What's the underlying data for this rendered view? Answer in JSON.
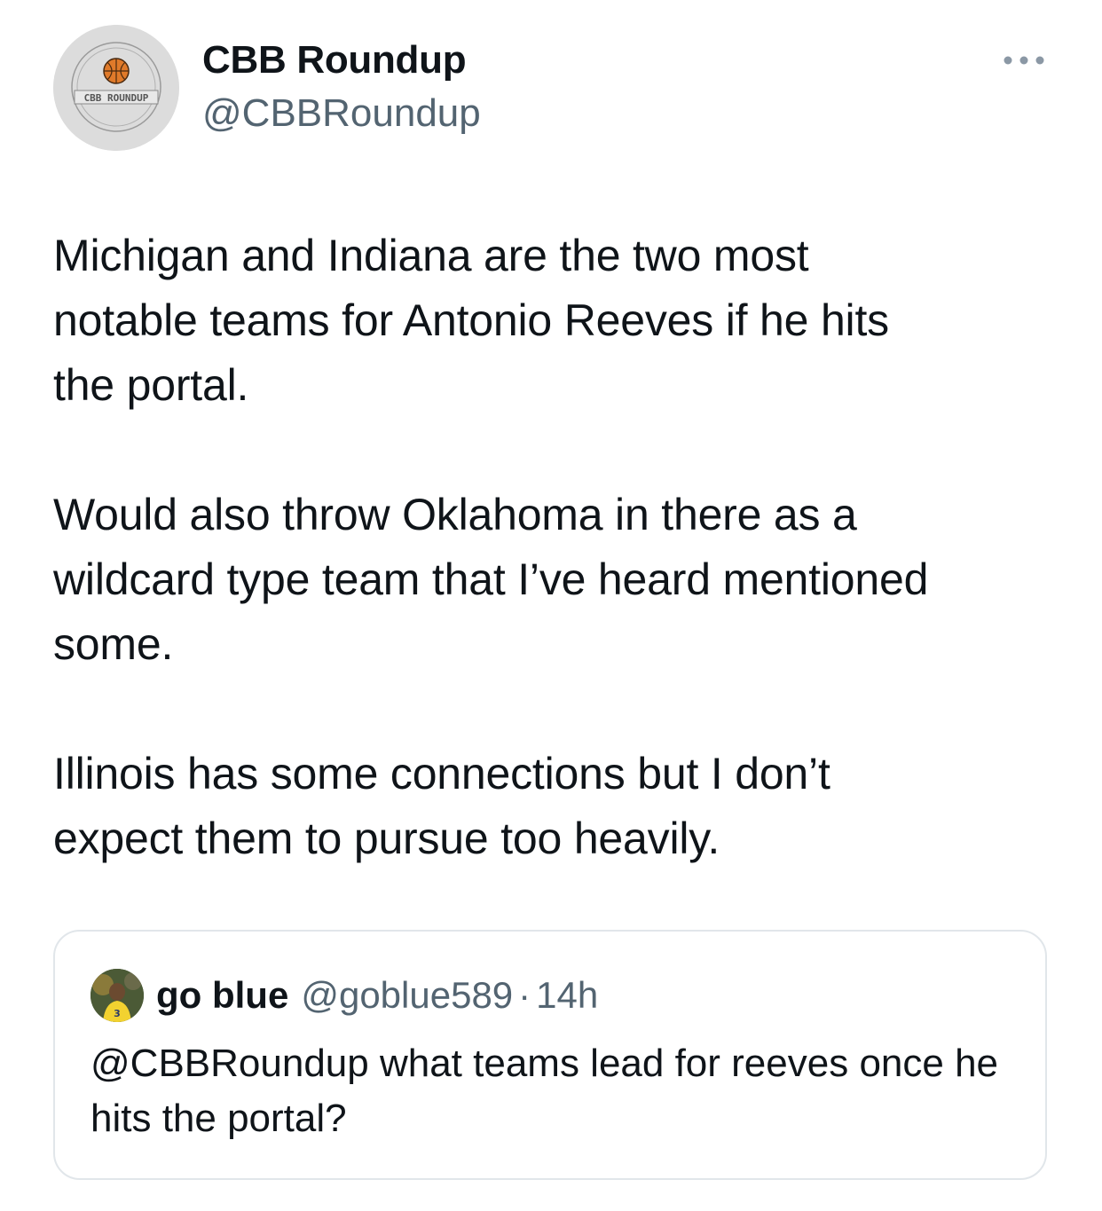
{
  "tweet": {
    "author": {
      "display_name": "CBB Roundup",
      "handle": "@CBBRoundup",
      "avatar_text": "CBB ROUNDUP",
      "avatar_icon": "basketball-logo"
    },
    "more_icon": "more-horizontal-icon",
    "paragraphs": [
      "Michigan and Indiana are the two most\nnotable teams for Antonio Reeves if he hits\nthe portal.",
      "Would also throw Oklahoma in there as a\nwildcard type team that I’ve heard mentioned\nsome.",
      "Illinois has some connections but I don’t\nexpect them to pursue too heavily."
    ]
  },
  "quoted_tweet": {
    "display_name": "go blue",
    "handle": "@goblue589",
    "separator": "·",
    "time": "14h",
    "text": "@CBBRoundup what teams lead for reeves once he hits the portal?"
  },
  "colors": {
    "text_primary": "#0f1419",
    "text_secondary": "#536471",
    "border": "#e1e6ea",
    "background": "#ffffff"
  }
}
